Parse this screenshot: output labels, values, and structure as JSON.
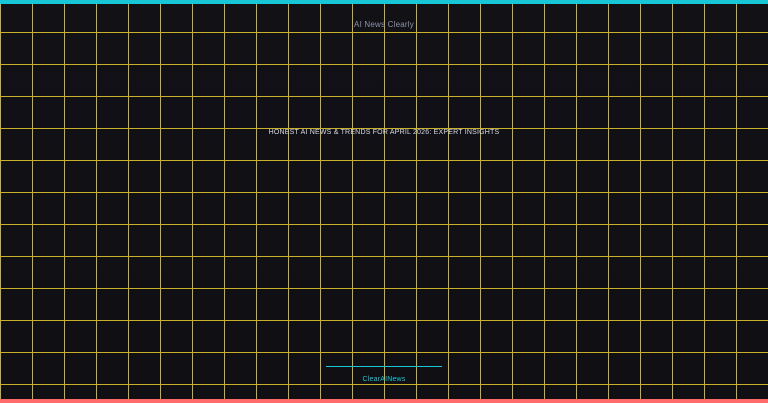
{
  "header": {
    "title": "AI News Clearly"
  },
  "hero": {
    "subtitle": "HONEST AI NEWS & TRENDS FOR APRIL 2026: EXPERT INSIGHTS"
  },
  "footer": {
    "link_label": "ClearAINews"
  },
  "colors": {
    "accent_top": "#18c7d6",
    "accent_bottom": "#ff6b6b",
    "grid": "#c9b22a",
    "background": "#0f0f14"
  }
}
